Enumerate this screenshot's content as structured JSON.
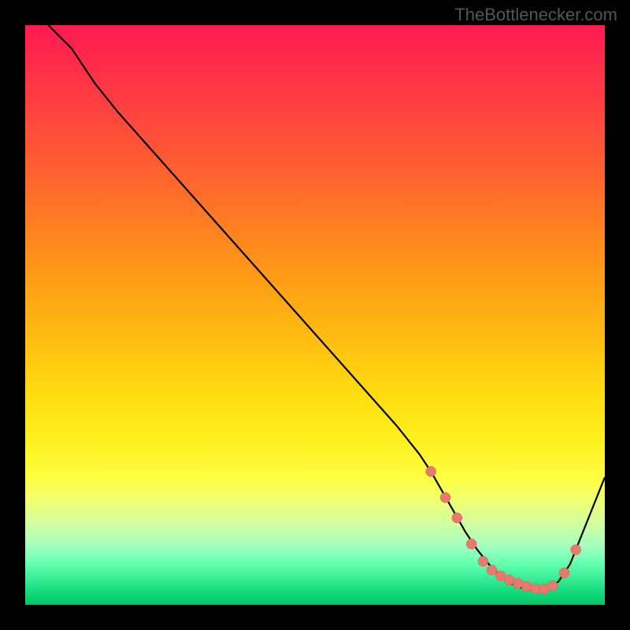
{
  "attribution": "TheBottlenecker.com",
  "chart_data": {
    "type": "line",
    "title": "",
    "xlabel": "",
    "ylabel": "",
    "x_range": [
      0,
      100
    ],
    "y_range": [
      0,
      100
    ],
    "curve": {
      "x": [
        4,
        8,
        12,
        16,
        20,
        24,
        28,
        32,
        36,
        40,
        44,
        48,
        52,
        56,
        60,
        64,
        68,
        70,
        72,
        74,
        76,
        78,
        80,
        82,
        84,
        86,
        88,
        90,
        92,
        94,
        96,
        98,
        100
      ],
      "y": [
        100,
        96,
        90,
        85,
        80.5,
        76,
        71.5,
        67,
        62.5,
        58,
        53.5,
        49,
        44.5,
        40,
        35.5,
        31,
        26,
        23,
        19.5,
        16,
        12.5,
        9.5,
        7,
        5,
        3.6,
        2.8,
        2.5,
        2.8,
        4,
        7,
        12,
        17,
        22
      ]
    },
    "markers": {
      "x": [
        70,
        72.5,
        74.5,
        77,
        79,
        80.5,
        82,
        83.5,
        85,
        86.5,
        88,
        89.5,
        91,
        93,
        95
      ],
      "y": [
        23,
        18.5,
        15,
        10.5,
        7.5,
        6,
        5,
        4.3,
        3.7,
        3.2,
        2.8,
        2.7,
        3.3,
        5.5,
        9.5
      ]
    },
    "background_gradient": {
      "direction": "vertical",
      "stops": [
        {
          "pos": 0.0,
          "color": "#ff1a52"
        },
        {
          "pos": 0.14,
          "color": "#ff4040"
        },
        {
          "pos": 0.35,
          "color": "#ff8020"
        },
        {
          "pos": 0.55,
          "color": "#ffc010"
        },
        {
          "pos": 0.72,
          "color": "#fff020"
        },
        {
          "pos": 0.86,
          "color": "#d0ffa0"
        },
        {
          "pos": 1.0,
          "color": "#04c864"
        }
      ]
    }
  }
}
